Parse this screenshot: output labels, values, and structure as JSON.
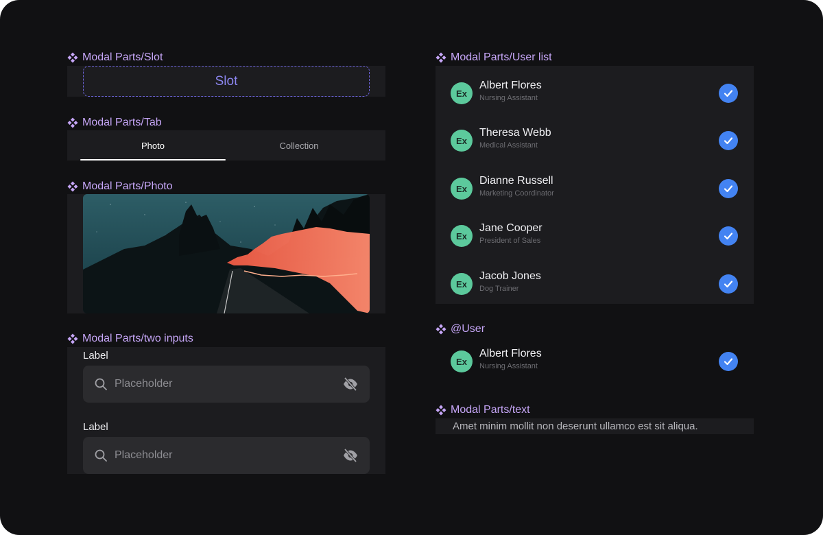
{
  "sections": {
    "slot": {
      "title": "Modal Parts/Slot",
      "slot_label": "Slot"
    },
    "tab": {
      "title": "Modal Parts/Tab",
      "tabs": [
        {
          "label": "Photo"
        },
        {
          "label": "Collection"
        }
      ]
    },
    "photo": {
      "title": "Modal Parts/Photo"
    },
    "two_inputs": {
      "title": "Modal Parts/two inputs",
      "fields": [
        {
          "label": "Label",
          "placeholder": "Placeholder"
        },
        {
          "label": "Label",
          "placeholder": "Placeholder"
        }
      ]
    },
    "user_list": {
      "title": "Modal Parts/User list",
      "users": [
        {
          "initials": "Ex",
          "name": "Albert Flores",
          "role": "Nursing Assistant"
        },
        {
          "initials": "Ex",
          "name": "Theresa Webb",
          "role": "Medical Assistant"
        },
        {
          "initials": "Ex",
          "name": "Dianne Russell",
          "role": "Marketing Coordinator"
        },
        {
          "initials": "Ex",
          "name": "Jane Cooper",
          "role": "President of Sales"
        },
        {
          "initials": "Ex",
          "name": "Jacob Jones",
          "role": "Dog Trainer"
        }
      ]
    },
    "user": {
      "title": "@User",
      "user": {
        "initials": "Ex",
        "name": "Albert Flores",
        "role": "Nursing Assistant"
      }
    },
    "text": {
      "title": "Modal Parts/text",
      "body": "Amet minim mollit non deserunt ullamco est sit aliqua."
    }
  },
  "colors": {
    "canvas": "#111113",
    "panel": "#1c1c1f",
    "accent_purple": "#c6a6f7",
    "slot_border": "#6b63d8",
    "avatar_green": "#5cc99c",
    "check_blue": "#4383f2"
  },
  "icons": {
    "section": "component-diamond-icon",
    "search": "search-icon",
    "visibility": "eye-off-icon",
    "check": "check-circle-icon"
  }
}
